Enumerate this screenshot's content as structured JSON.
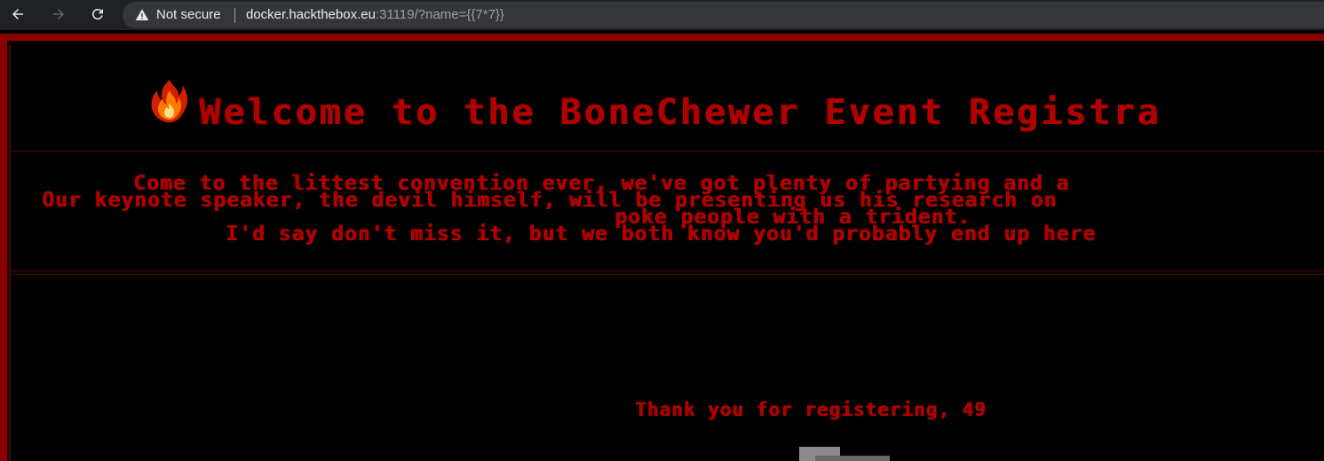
{
  "browser": {
    "security_label": "Not secure",
    "url_host": "docker.hackthebox.eu",
    "url_rest": ":31119/?name={{7*7}}"
  },
  "page": {
    "title": "Welcome to the BoneChewer Event Registra",
    "description_lines": [
      "Come to the littest convention ever, we've got plenty of partying and a",
      "Our keynote speaker, the devil himself, will be presenting us his research on",
      "poke people with a trident.",
      "I'd say don't miss it, but we both know you'd probably end up here"
    ],
    "thanks_message": "Thank you for registering, 49"
  },
  "colors": {
    "accent_red": "#b00000",
    "border_red": "#8b0000",
    "background": "#000000"
  },
  "icons": [
    "back-arrow-icon",
    "forward-arrow-icon",
    "reload-icon",
    "warning-icon",
    "fire-icon"
  ]
}
